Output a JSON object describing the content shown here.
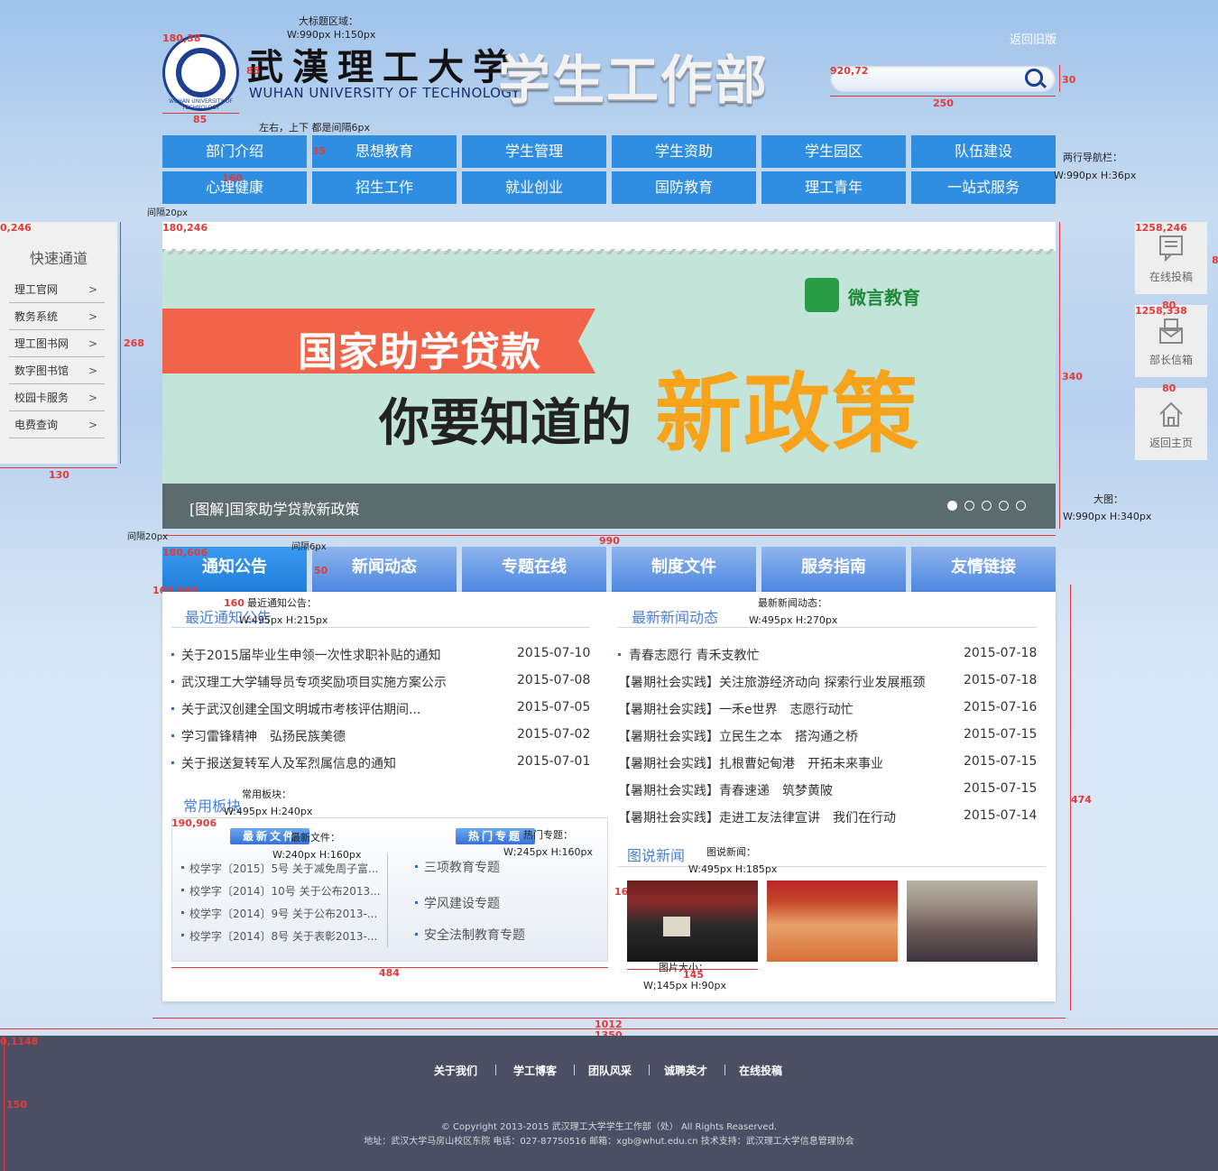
{
  "header": {
    "brand_cn": "武漢理工大学",
    "brand_en": "WUHAN UNIVERSITY OF TECHNOLOGY",
    "dept": "学生工作部",
    "back_old": "返回旧版",
    "logo_text": "WUHAN UNIVERSITY OF TECHNOLOGY",
    "search_placeholder": ""
  },
  "nav": {
    "row1": [
      "部门介绍",
      "思想教育",
      "学生管理",
      "学生资助",
      "学生园区",
      "队伍建设"
    ],
    "row2": [
      "心理健康",
      "招生工作",
      "就业创业",
      "国防教育",
      "理工青年",
      "一站式服务"
    ]
  },
  "quick": {
    "title": "快速通道",
    "items": [
      "理工官网",
      "教务系统",
      "理工图书网",
      "数字图书馆",
      "校园卡服务",
      "电费查询"
    ],
    "arrow": ">"
  },
  "side": {
    "items": [
      {
        "label": "在线投稿",
        "icon": "edit-doc-icon"
      },
      {
        "label": "部长信箱",
        "icon": "mailbox-icon"
      },
      {
        "label": "返回主页",
        "icon": "home-icon"
      }
    ]
  },
  "banner": {
    "brand": "微言教育",
    "line1": "国家助学贷款",
    "line2": "你要知道的",
    "line3": "新政策",
    "caption": "[图解]国家助学贷款新政策",
    "slide_count": 5,
    "active_slide": 1
  },
  "tabs": [
    "通知公告",
    "新闻动态",
    "专题在线",
    "制度文件",
    "服务指南",
    "友情链接"
  ],
  "notices": {
    "title": "最近通知公告",
    "items": [
      {
        "text": "关于2015届毕业生申领一次性求职补贴的通知",
        "date": "2015-07-10"
      },
      {
        "text": "武汉理工大学辅导员专项奖励项目实施方案公示",
        "date": "2015-07-08"
      },
      {
        "text": "关于武汉创建全国文明城市考核评估期间...",
        "date": "2015-07-05"
      },
      {
        "text": "学习雷锋精神　弘扬民族美德",
        "date": "2015-07-02"
      },
      {
        "text": "关于报送复转军人及军烈属信息的通知",
        "date": "2015-07-01"
      }
    ]
  },
  "news": {
    "title": "最新新闻动态",
    "items": [
      {
        "text": "青春志愿行 青禾支教忙",
        "date": "2015-07-18"
      },
      {
        "text": "【暑期社会实践】关注旅游经济动向 探索行业发展瓶颈",
        "date": "2015-07-18"
      },
      {
        "text": "【暑期社会实践】一禾e世界　志愿行动忙",
        "date": "2015-07-16"
      },
      {
        "text": "【暑期社会实践】立民生之本　搭沟通之桥",
        "date": "2015-07-15"
      },
      {
        "text": "【暑期社会实践】扎根曹妃甸港　开拓未来事业",
        "date": "2015-07-15"
      },
      {
        "text": "【暑期社会实践】青春速递　筑梦黄陂",
        "date": "2015-07-15"
      },
      {
        "text": "【暑期社会实践】走进工友法律宣讲　我们在行动",
        "date": "2015-07-14"
      }
    ]
  },
  "common": {
    "title": "常用板块",
    "files_label": "最新文件",
    "topics_label": "热门专题",
    "files": [
      "校学字〔2015〕5号 关于减免周子富...",
      "校学字〔2014〕10号 关于公布2013...",
      "校学字〔2014〕9号 关于公布2013-...",
      "校学字〔2014〕8号 关于表彰2013-..."
    ],
    "topics": [
      "三项教育专题",
      "学风建设专题",
      "安全法制教育专题"
    ]
  },
  "pictures": {
    "title": "图说新闻"
  },
  "annotations": {
    "title_area": "大标题区域：",
    "title_size": "W:990px  H:150px",
    "logo_pos": "180,38",
    "logo_h": "85",
    "logo_w": "85",
    "spacing_note": "左右，上下 都是间隔6px",
    "search_pos": "920,72",
    "search_h": "30",
    "search_w": "250",
    "nav_h": "35",
    "nav_w": "160",
    "nav_note1": "两行导航栏：",
    "nav_note2": "W:990px  H:36px",
    "gap20a": "间隔20px",
    "quick_pos": "0,246",
    "quick_h": "268",
    "quick_w": "130",
    "banner_pos": "180,246",
    "banner_h": "340",
    "banner_note1": "大图：",
    "banner_note2": "W:990px  H:340px",
    "banner_w": "990",
    "side_pos1": "1258,246",
    "side_pos2": "1258,338",
    "side_w1": "80",
    "side_w2": "80",
    "side_h": "8",
    "gap20b": "间隔20px",
    "gap6": "间隔6px",
    "tabs_pos": "180,606",
    "tabs_h": "50",
    "content_pos": "169,648",
    "notice_w": "160",
    "notice_note1": "最近通知公告：",
    "notice_note2": "W:495px  H:215px",
    "news_note1": "最新新闻动态：",
    "news_note2": "W:495px  H:270px",
    "common_note1": "常用板块：",
    "common_note2": "W:495px H:240px",
    "common_pos": "190,906",
    "files_note1": "最新文件：",
    "files_note2": "W:240px H:160px",
    "topics_note1": "热门专题：",
    "topics_note2": "W;245px H:160px",
    "pics_note1": "图说新闻：",
    "pics_note2": "W:495px H:185px",
    "pic_h": "160",
    "pic_h2": "90",
    "pic_w": "145",
    "pic_note1": "图片大小：",
    "pic_note2": "W;145px H:90px",
    "common_w": "484",
    "content_h": "474",
    "content_w": "1012",
    "page_w": "1350",
    "footer_pos": "0,1148",
    "footer_h": "150"
  },
  "footer": {
    "links": [
      "关于我们",
      "学工博客",
      "团队风采",
      "诚聘英才",
      "在线投稿"
    ],
    "copyright": "© Copyright 2013-2015  武汉理工大学学生工作部（处） All Rights Reaserved.",
    "address": "地址：武汉大学马房山校区东院 电话：027-87750516  邮箱：xgb@whut.edu.cn   技术支持：武汉理工大学信息管理协会"
  },
  "colors": {
    "nav_blue": "#2f8ee2",
    "tab_blue": "#4c87e0",
    "footer_bg": "#4b4f63",
    "banner_orange": "#f7a31c",
    "banner_red": "#f2644a"
  }
}
